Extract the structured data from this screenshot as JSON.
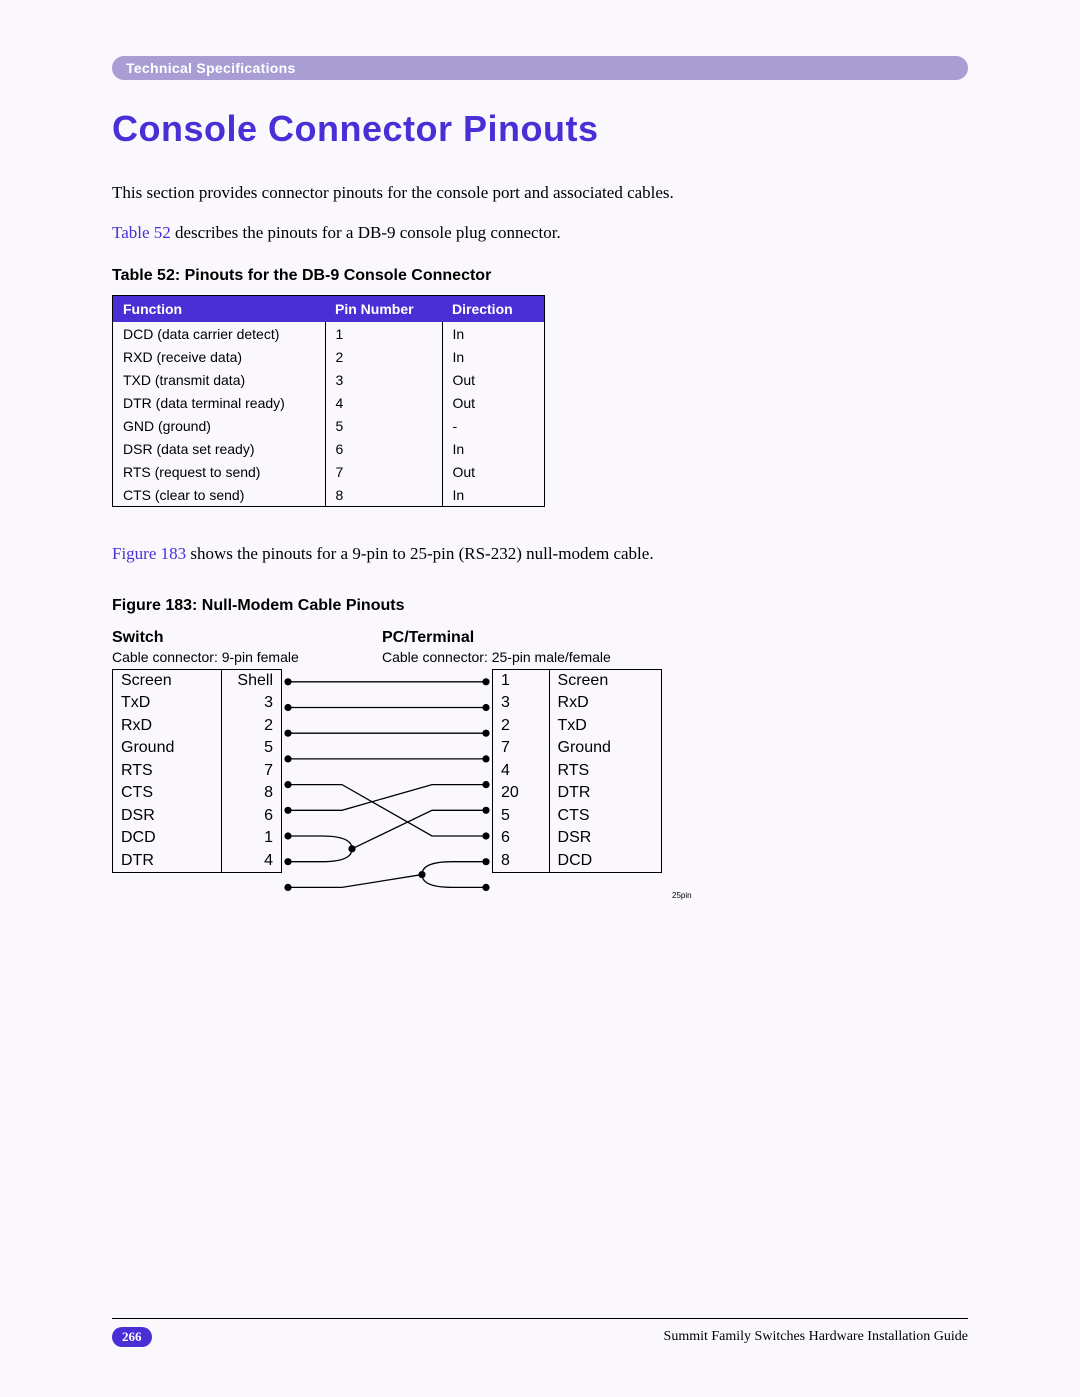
{
  "header": {
    "breadcrumb": "Technical Specifications"
  },
  "title": "Console Connector Pinouts",
  "para1": "This section provides connector pinouts for the console port and associated cables.",
  "para2_link": "Table 52",
  "para2_rest": " describes the pinouts for a DB-9 console plug connector.",
  "table52": {
    "caption": "Table 52: Pinouts for the DB-9 Console Connector",
    "headers": {
      "func": "Function",
      "pin": "Pin Number",
      "dir": "Direction"
    },
    "rows": [
      {
        "func": "DCD (data carrier detect)",
        "pin": "1",
        "dir": "In"
      },
      {
        "func": "RXD (receive data)",
        "pin": "2",
        "dir": "In"
      },
      {
        "func": "TXD (transmit data)",
        "pin": "3",
        "dir": "Out"
      },
      {
        "func": "DTR (data terminal ready)",
        "pin": "4",
        "dir": "Out"
      },
      {
        "func": "GND (ground)",
        "pin": "5",
        "dir": "-"
      },
      {
        "func": "DSR (data set ready)",
        "pin": "6",
        "dir": "In"
      },
      {
        "func": "RTS (request to send)",
        "pin": "7",
        "dir": "Out"
      },
      {
        "func": "CTS (clear to send)",
        "pin": "8",
        "dir": "In"
      }
    ]
  },
  "para3_link": "Figure 183",
  "para3_rest": " shows the pinouts for a 9-pin to 25-pin (RS-232) null-modem cable.",
  "figure183": {
    "caption": "Figure 183: Null-Modem Cable Pinouts",
    "left_header": "Switch",
    "right_header": "PC/Terminal",
    "left_sub": "Cable connector: 9-pin female",
    "right_sub": "Cable connector: 25-pin male/female",
    "left_rows": [
      {
        "label": "Screen",
        "pin": "Shell"
      },
      {
        "label": "TxD",
        "pin": "3"
      },
      {
        "label": "RxD",
        "pin": "2"
      },
      {
        "label": "Ground",
        "pin": "5"
      },
      {
        "label": "RTS",
        "pin": "7"
      },
      {
        "label": "CTS",
        "pin": "8"
      },
      {
        "label": "DSR",
        "pin": "6"
      },
      {
        "label": "DCD",
        "pin": "1"
      },
      {
        "label": "DTR",
        "pin": "4"
      }
    ],
    "right_rows": [
      {
        "pin": "1",
        "label": "Screen"
      },
      {
        "pin": "3",
        "label": "RxD"
      },
      {
        "pin": "2",
        "label": "TxD"
      },
      {
        "pin": "7",
        "label": "Ground"
      },
      {
        "pin": "4",
        "label": "RTS"
      },
      {
        "pin": "20",
        "label": "DTR"
      },
      {
        "pin": "5",
        "label": "CTS"
      },
      {
        "pin": "6",
        "label": "DSR"
      },
      {
        "pin": "8",
        "label": "DCD"
      }
    ],
    "connections": [
      {
        "from": 0,
        "to": 0,
        "type": "straight"
      },
      {
        "from": 1,
        "to": 1,
        "type": "straight"
      },
      {
        "from": 2,
        "to": 2,
        "type": "straight"
      },
      {
        "from": 3,
        "to": 3,
        "type": "straight"
      },
      {
        "from": 4,
        "to": 6,
        "type": "cross"
      },
      {
        "from": 5,
        "to": 4,
        "type": "cross"
      },
      {
        "from": 6,
        "to": 5,
        "type": "merge-in"
      },
      {
        "from": 7,
        "to": 5,
        "type": "merge-in"
      },
      {
        "from": 8,
        "to": 7,
        "type": "split-out"
      },
      {
        "from": 8,
        "to": 8,
        "type": "split-out"
      }
    ],
    "tinylabel": "25pin"
  },
  "footer": {
    "page_number": "266",
    "guide": "Summit Family Switches Hardware Installation Guide"
  }
}
